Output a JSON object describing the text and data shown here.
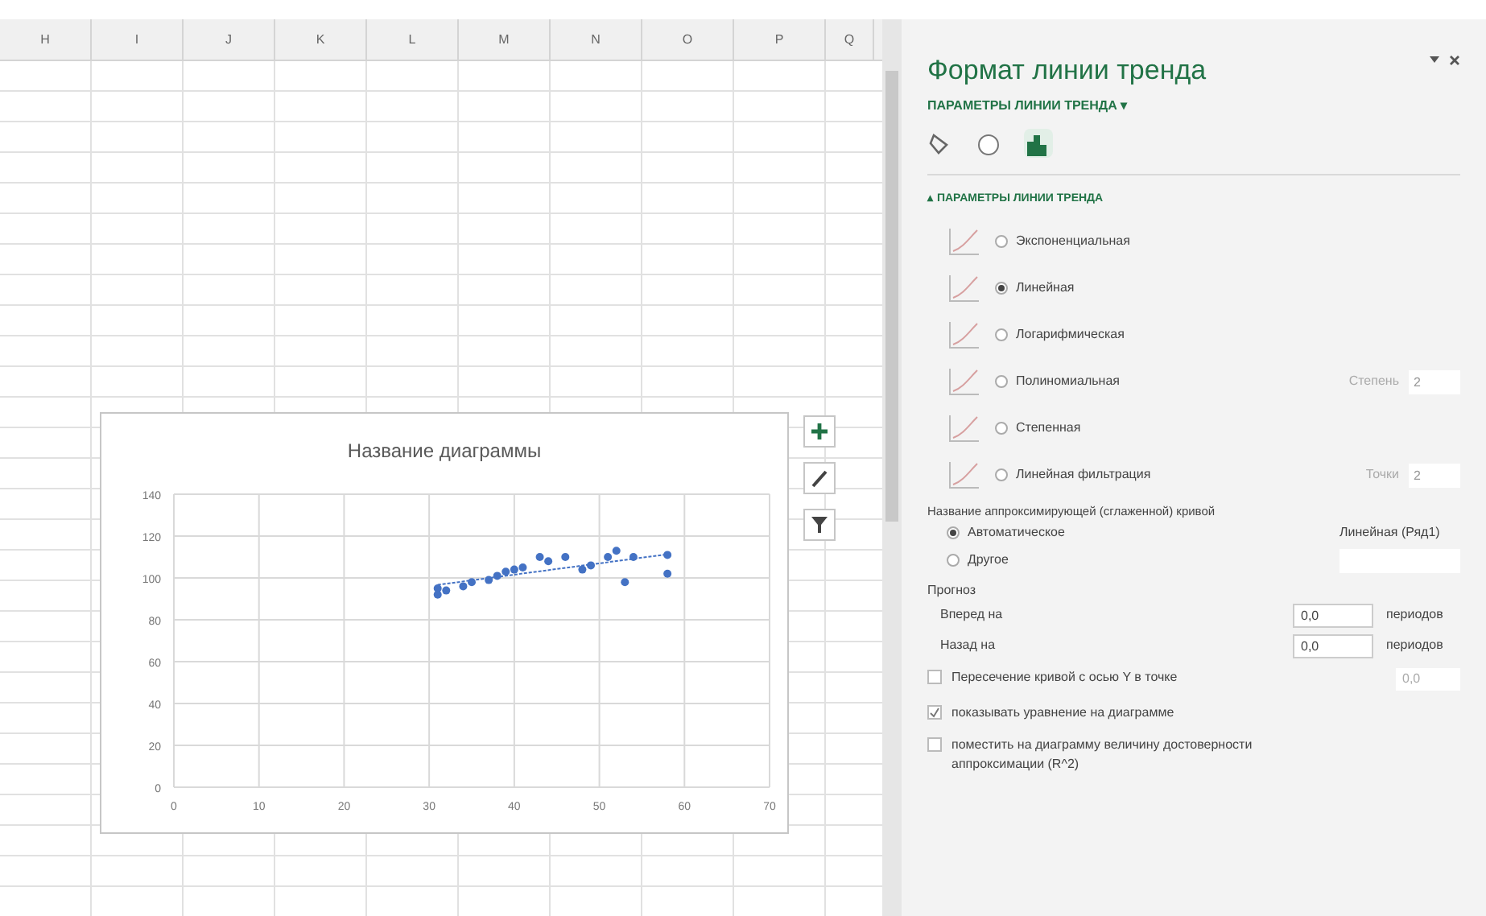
{
  "sheet": {
    "columns": [
      "H",
      "I",
      "J",
      "K",
      "L",
      "M",
      "N",
      "O",
      "P",
      "Q"
    ]
  },
  "chart": {
    "title": "Название диаграммы",
    "chart_data": {
      "type": "scatter",
      "grid": true,
      "x": [
        31,
        31,
        32,
        34,
        35,
        37,
        38,
        39,
        40,
        41,
        43,
        44,
        46,
        48,
        49,
        51,
        52,
        53,
        54,
        58,
        58
      ],
      "series": [
        {
          "type": "line",
          "line_style": "dashed",
          "color": "#4472c4",
          "values": [
            96.7,
            null,
            null,
            null,
            null,
            null,
            null,
            null,
            null,
            null,
            null,
            null,
            null,
            null,
            null,
            null,
            null,
            null,
            null,
            null,
            111.3
          ]
        },
        {
          "type": "scatter",
          "color": "#4472c4",
          "values": [
            92,
            95,
            94,
            96,
            98,
            99,
            101,
            103,
            104,
            105,
            110,
            108,
            110,
            104,
            106,
            110,
            113,
            98,
            110,
            102,
            111
          ]
        }
      ],
      "xlim": [
        0,
        70
      ],
      "ylim": [
        0,
        140
      ],
      "xticks": [
        0,
        10,
        20,
        30,
        40,
        50,
        60,
        70
      ],
      "yticks": [
        0,
        20,
        40,
        60,
        80,
        100,
        120,
        140
      ]
    }
  },
  "panel": {
    "title": "Формат линии тренда",
    "subtitle": "ПАРАМЕТРЫ ЛИНИИ ТРЕНДА ▾",
    "tabs": [
      {
        "kind": "fill",
        "selected": false
      },
      {
        "kind": "effects",
        "selected": false
      },
      {
        "kind": "options",
        "selected": true
      }
    ],
    "section": "▴ ПАРАМЕТРЫ ЛИНИИ ТРЕНДА",
    "types": [
      {
        "label": "Экспоненциальная",
        "selected": false
      },
      {
        "label": "Линейная",
        "selected": true
      },
      {
        "label": "Логарифмическая",
        "selected": false
      },
      {
        "label": "Полиномиальная",
        "selected": false,
        "param_label": "Степень",
        "param_value": "2"
      },
      {
        "label": "Степенная",
        "selected": false
      },
      {
        "label": "Линейная фильтрация",
        "selected": false,
        "param_label": "Точки",
        "param_value": "2"
      }
    ],
    "name_heading": "Название аппроксимирующей (сглаженной) кривой",
    "name_options": [
      {
        "label": "Автоматическое",
        "selected": true,
        "value": "Линейная (Ряд1)"
      },
      {
        "label": "Другое",
        "selected": false
      }
    ],
    "forecast_heading": "Прогноз",
    "forecast": [
      {
        "label": "Вперед на",
        "value": "0,0",
        "unit": "периодов"
      },
      {
        "label": "Назад на",
        "value": "0,0",
        "unit": "периодов"
      }
    ],
    "checks": [
      {
        "label": "Пересечение кривой с осью Y в точке",
        "checked": false,
        "placeholder": "0,0"
      },
      {
        "label": "показывать уравнение на диаграмме",
        "checked": true
      },
      {
        "label": "поместить на диаграмму величину достоверности аппроксимации (R^2)",
        "checked": false
      }
    ]
  }
}
